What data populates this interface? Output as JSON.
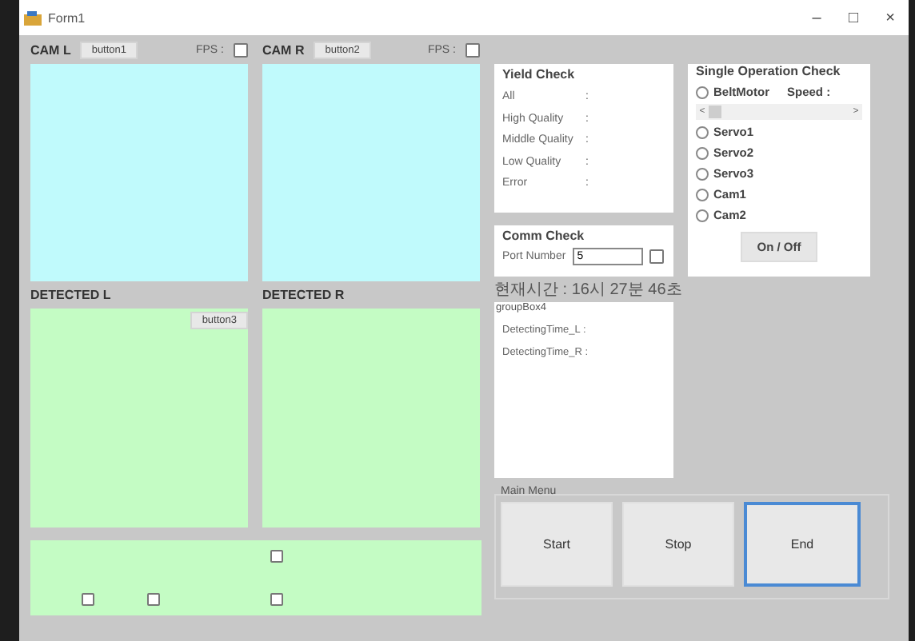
{
  "window": {
    "title": "Form1",
    "controls": [
      "–",
      "□",
      "×"
    ]
  },
  "cameras": [
    {
      "label": "CAM L",
      "button": "button1",
      "fps": "FPS :",
      "checked": false
    },
    {
      "label": "CAM R",
      "button": "button2",
      "fps": "FPS :",
      "checked": false
    }
  ],
  "detected": [
    {
      "label": "DETECTED L",
      "button": "button3"
    },
    {
      "label": "DETECTED R"
    }
  ],
  "bottom_checkboxes": [
    {
      "checked": false
    },
    {
      "checked": false
    },
    {
      "checked": false
    },
    {
      "checked": false
    }
  ],
  "yield_check": {
    "title": "Yield Check",
    "rows": [
      {
        "label": "All",
        "value": ":"
      },
      {
        "label": "High Quality",
        "value": ":"
      },
      {
        "label": "Middle Quality",
        "value": ":"
      },
      {
        "label": "Low Quality",
        "value": ":"
      },
      {
        "label": "Error",
        "value": ":"
      }
    ]
  },
  "single_operation": {
    "title": "Single Operation Check",
    "items": [
      {
        "kind": "radio",
        "label": "BeltMotor",
        "selected": false,
        "extra": "Speed :"
      },
      {
        "kind": "scrollbar",
        "left": "<",
        "right": ">"
      },
      {
        "kind": "radio",
        "label": "Servo1",
        "selected": false
      },
      {
        "kind": "radio",
        "label": "Servo2",
        "selected": false
      },
      {
        "kind": "radio",
        "label": "Servo3",
        "selected": false
      },
      {
        "kind": "radio",
        "label": "Cam1",
        "selected": false
      },
      {
        "kind": "radio",
        "label": "Cam2",
        "selected": false
      }
    ],
    "button": "On / Off"
  },
  "comm_check": {
    "title": "Comm Check",
    "label": "Port Number",
    "value": "5",
    "checked": false
  },
  "current_time": "현재시간 : 16시 27분 46초",
  "group_box4": {
    "title": "groupBox4",
    "rows": [
      "DetectingTime_L :",
      "DetectingTime_R :"
    ]
  },
  "main_menu": {
    "title": "Main Menu",
    "buttons": [
      {
        "label": "Start",
        "focused": false
      },
      {
        "label": "Stop",
        "focused": false
      },
      {
        "label": "End",
        "focused": true
      }
    ]
  }
}
